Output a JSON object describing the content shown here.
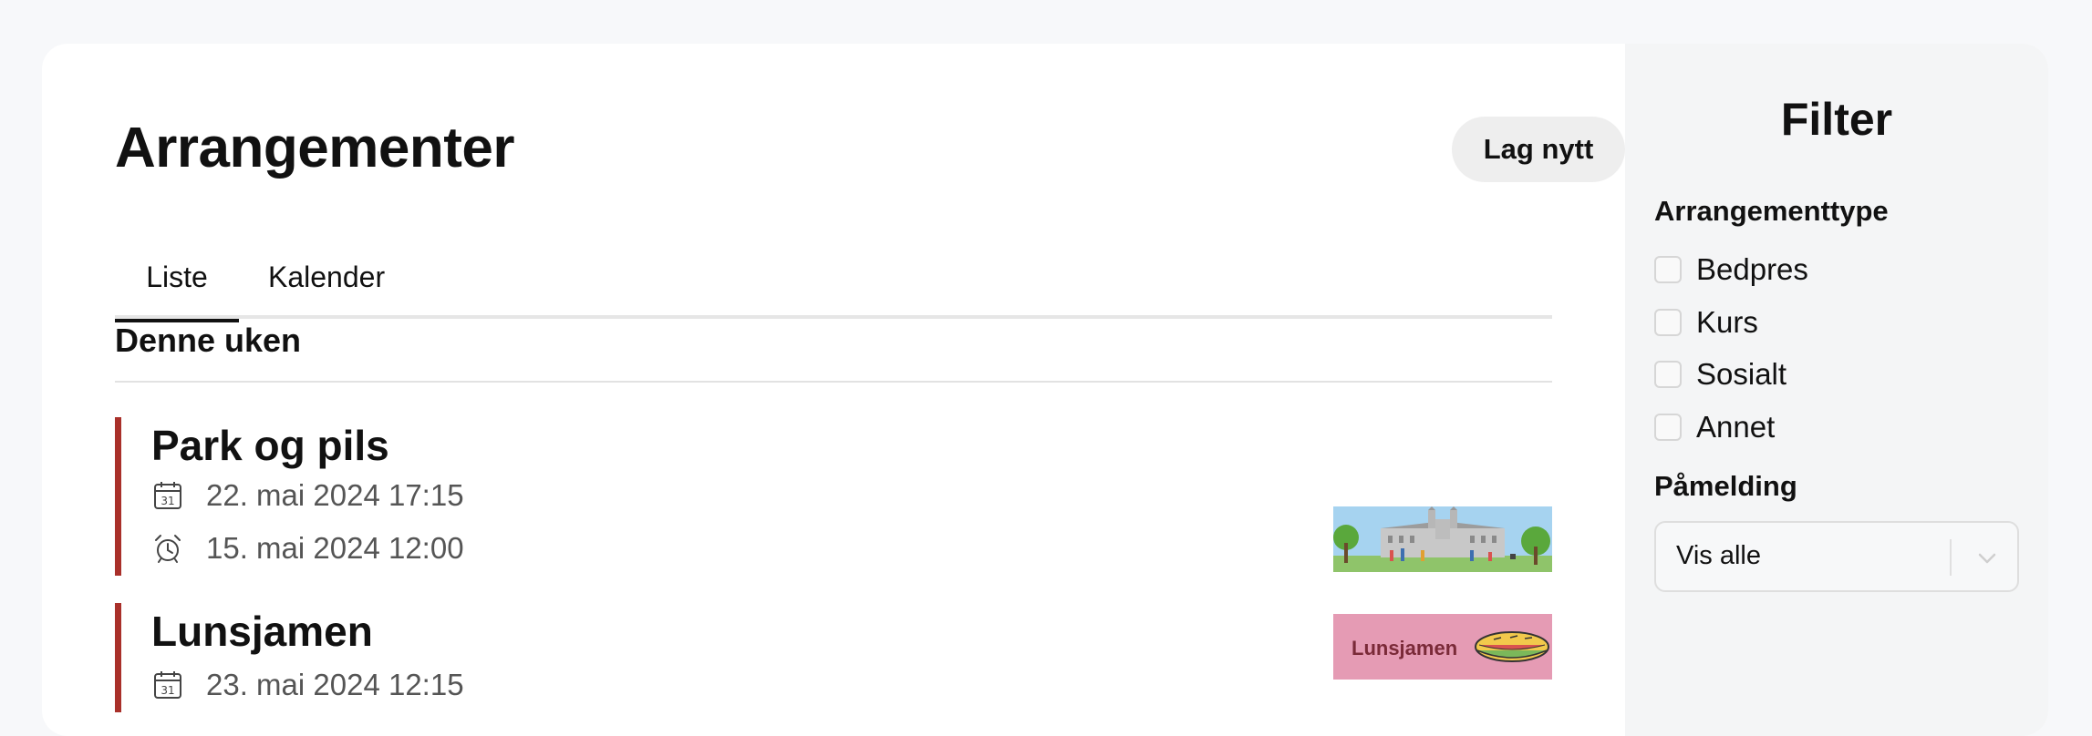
{
  "main": {
    "title": "Arrangementer",
    "new_button_label": "Lag nytt",
    "tabs": [
      {
        "label": "Liste",
        "active": true
      },
      {
        "label": "Kalender",
        "active": false
      }
    ],
    "section_title": "Denne uken",
    "events": [
      {
        "title": "Park og pils",
        "event_date": "22. mai 2024 17:15",
        "registration_date": "15. mai 2024 12:00",
        "image": "park-illustration",
        "accent_color": "#a9302a"
      },
      {
        "title": "Lunsjamen",
        "event_date": "23. mai 2024 12:15",
        "image": "lunsjamen-banner",
        "image_text": "Lunsjamen",
        "accent_color": "#a9302a"
      }
    ],
    "icons": {
      "event_date": "calendar-icon",
      "registration_date": "alarm-clock-icon"
    }
  },
  "sidebar": {
    "title": "Filter",
    "type_group_title": "Arrangementtype",
    "type_options": [
      {
        "label": "Bedpres",
        "checked": false
      },
      {
        "label": "Kurs",
        "checked": false
      },
      {
        "label": "Sosialt",
        "checked": false
      },
      {
        "label": "Annet",
        "checked": false
      }
    ],
    "signup_group_title": "Påmelding",
    "signup_select_value": "Vis alle"
  },
  "colors": {
    "page_background": "#f7f8fa",
    "card_background": "#ffffff",
    "sidebar_background": "#f4f5f6",
    "accent": "#a9302a",
    "button_background": "#eeeeee"
  }
}
